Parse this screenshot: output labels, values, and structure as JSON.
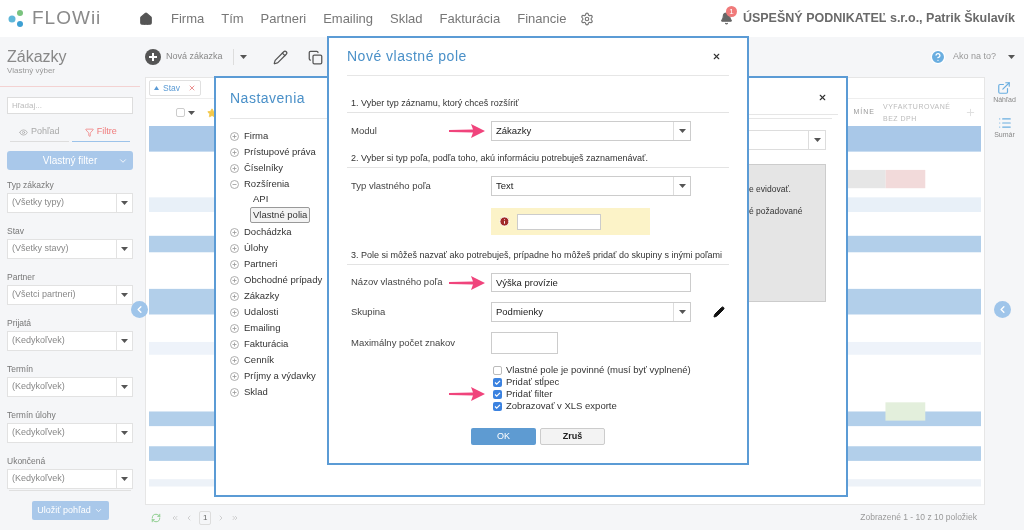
{
  "top_nav": {
    "logo": "FLOWii",
    "items": [
      "Firma",
      "Tím",
      "Partneri",
      "Emailing",
      "Sklad",
      "Fakturácia",
      "Financie"
    ],
    "notification_count": "1",
    "account": "ÚSPEŠNÝ PODNIKATEĽ s.r.o., Patrik Škulavík"
  },
  "page_header": {
    "title": "Zákazky",
    "subtitle": "Vlastný výber",
    "new_button": "Nová zákazka",
    "help": "Ako na to?"
  },
  "sidebar": {
    "search_placeholder": "Hľadaj...",
    "tabs": [
      {
        "label": "Pohľad",
        "selected": false
      },
      {
        "label": "Filtre",
        "selected": true
      }
    ],
    "custom_filter": "Vlastný filter",
    "filters": [
      {
        "label": "Typ zákazky",
        "value": "(Všetky typy)"
      },
      {
        "label": "Stav",
        "value": "(Všetky stavy)"
      },
      {
        "label": "Partner",
        "value": "(Všetci partneri)"
      },
      {
        "label": "Prijatá",
        "value": "(Kedykoľvek)"
      },
      {
        "label": "Termín",
        "value": "(Kedykoľvek)"
      },
      {
        "label": "Termín úlohy",
        "value": "(Kedykoľvek)"
      },
      {
        "label": "Ukončená",
        "value": "(Kedykoľvek)"
      }
    ],
    "save_button": "Uložiť pohľad"
  },
  "table": {
    "filter_chip": "Stav",
    "select_all_checked": false,
    "columns": [
      "MÍNE",
      "VYFAKTUROVANÉ BEZ DPH"
    ],
    "pager": {
      "page": "1",
      "summary": "Zobrazené 1 - 10 z 10 položiek"
    }
  },
  "right_rail": [
    {
      "kind": "preview",
      "label": "Náhľad"
    },
    {
      "kind": "summary",
      "label": "Sumár"
    }
  ],
  "settings_dialog": {
    "title": "Nastavenia",
    "fragments": [
      "e evidovať.",
      "é požadované"
    ],
    "tree": [
      {
        "label": "Firma",
        "expanded": false
      },
      {
        "label": "Prístupové práva",
        "expanded": false
      },
      {
        "label": "Číselníky",
        "expanded": false
      },
      {
        "label": "Rozšírenia",
        "expanded": true,
        "children": [
          {
            "label": "API",
            "selected": false
          },
          {
            "label": "Vlastné polia",
            "selected": true
          }
        ]
      },
      {
        "label": "Dochádzka",
        "expanded": false
      },
      {
        "label": "Úlohy",
        "expanded": false
      },
      {
        "label": "Partneri",
        "expanded": false
      },
      {
        "label": "Obchodné prípady",
        "expanded": false
      },
      {
        "label": "Zákazky",
        "expanded": false
      },
      {
        "label": "Udalosti",
        "expanded": false
      },
      {
        "label": "Emailing",
        "expanded": false
      },
      {
        "label": "Fakturácia",
        "expanded": false
      },
      {
        "label": "Cenník",
        "expanded": false
      },
      {
        "label": "Príjmy a výdavky",
        "expanded": false
      },
      {
        "label": "Sklad",
        "expanded": false
      }
    ]
  },
  "new_field_dialog": {
    "title": "Nové vlastné pole",
    "steps": [
      {
        "heading": "1. Vyber typ záznamu, ktorý chceš rozšíriť",
        "rows": [
          {
            "kind": "select",
            "label": "Modul",
            "value": "Zákazky",
            "pointer": true
          }
        ]
      },
      {
        "heading": "2. Vyber si typ poľa, podľa toho, akú informáciu potrebuješ zaznamenávať.",
        "rows": [
          {
            "kind": "select",
            "label": "Typ vlastného poľa",
            "value": "Text"
          },
          {
            "kind": "warning"
          }
        ]
      },
      {
        "heading": "3. Pole si môžeš nazvať ako potrebuješ, prípadne ho môžeš pridať do skupiny s inými poľami",
        "rows": [
          {
            "kind": "input",
            "label": "Názov vlastného poľa",
            "value": "Výška provízie",
            "pointer": true
          },
          {
            "kind": "select",
            "label": "Skupina",
            "value": "Podmienky",
            "editable": true
          },
          {
            "kind": "short_input",
            "label": "Maximálny počet znakov"
          }
        ]
      }
    ],
    "options": [
      {
        "label": "Vlastné pole je povinné (musí byť vyplnené)",
        "checked": false
      },
      {
        "label": "Pridať stĺpec",
        "checked": true
      },
      {
        "label": "Pridať filter",
        "checked": true,
        "pointer": true
      },
      {
        "label": "Zobrazovať v XLS exporte",
        "checked": true
      }
    ],
    "buttons": [
      {
        "kind": "primary",
        "label": "OK"
      },
      {
        "kind": "secondary",
        "label": "Zruš"
      }
    ]
  }
}
